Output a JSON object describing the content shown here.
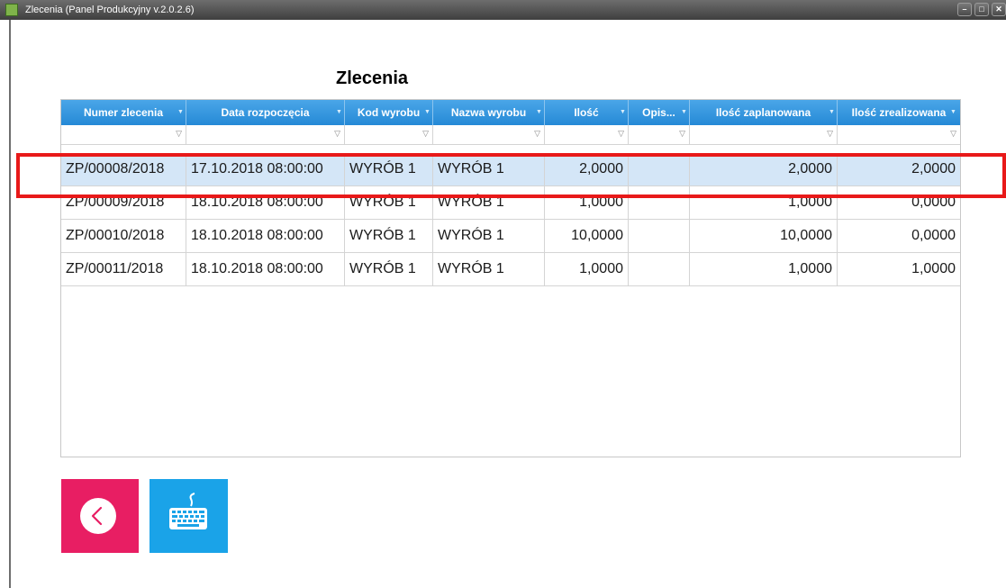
{
  "window": {
    "title": "Zlecenia (Panel Produkcyjny v.2.0.2.6)",
    "minimize_glyph": "–",
    "maximize_glyph": "□",
    "close_glyph": "✕"
  },
  "page": {
    "heading": "Zlecenia"
  },
  "table": {
    "columns": [
      "Numer zlecenia",
      "Data rozpoczęcia",
      "Kod wyrobu",
      "Nazwa wyrobu",
      "Ilość",
      "Opis...",
      "Ilość zaplanowana",
      "Ilość zrealizowana"
    ],
    "rows": [
      {
        "numer": "ZP/00008/2018",
        "data": "17.10.2018 08:00:00",
        "kod": "WYRÓB 1",
        "nazwa": "WYRÓB 1",
        "ilosc": "2,0000",
        "opis": "",
        "zaplanowana": "2,0000",
        "zrealizowana": "2,0000",
        "selected": true
      },
      {
        "numer": "ZP/00009/2018",
        "data": "18.10.2018 08:00:00",
        "kod": "WYRÓB 1",
        "nazwa": "WYRÓB 1",
        "ilosc": "1,0000",
        "opis": "",
        "zaplanowana": "1,0000",
        "zrealizowana": "0,0000",
        "selected": false
      },
      {
        "numer": "ZP/00010/2018",
        "data": "18.10.2018 08:00:00",
        "kod": "WYRÓB 1",
        "nazwa": "WYRÓB 1",
        "ilosc": "10,0000",
        "opis": "",
        "zaplanowana": "10,0000",
        "zrealizowana": "0,0000",
        "selected": false
      },
      {
        "numer": "ZP/00011/2018",
        "data": "18.10.2018 08:00:00",
        "kod": "WYRÓB 1",
        "nazwa": "WYRÓB 1",
        "ilosc": "1,0000",
        "opis": "",
        "zaplanowana": "1,0000",
        "zrealizowana": "1,0000",
        "selected": false
      }
    ]
  },
  "colors": {
    "header_blue": "#2589d6",
    "selected_row": "#d4e6f7",
    "highlight_red": "#e81919",
    "back_button": "#e81e63",
    "keyboard_button": "#1aa3e8"
  },
  "icons": {
    "back": "chevron-left-icon",
    "keyboard": "keyboard-icon",
    "filter": "filter-icon"
  }
}
